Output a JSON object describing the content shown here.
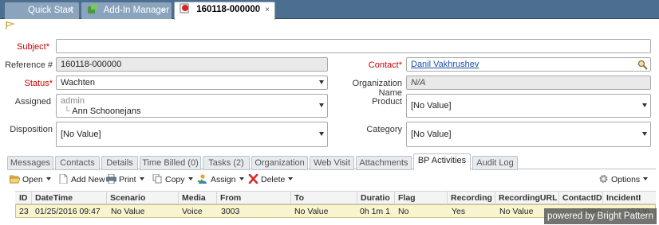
{
  "tabs": [
    {
      "label": "Quick Start",
      "close": "×"
    },
    {
      "label": "Add-In Manager",
      "close": "×"
    },
    {
      "label": "160118-000000",
      "close": "×"
    }
  ],
  "form": {
    "subject": {
      "label": "Subject",
      "required": "*",
      "value": ""
    },
    "reference": {
      "label": "Reference #",
      "value": "160118-000000"
    },
    "status": {
      "label": "Status",
      "required": "*",
      "value": "Wachten"
    },
    "assigned": {
      "label": "Assigned",
      "group": "admin",
      "tree_prefix": "└",
      "value": "Ann Schoonejans"
    },
    "disposition": {
      "label": "Disposition",
      "value": "[No Value]"
    },
    "contact": {
      "label": "Contact",
      "required": "*",
      "value": "Danil Vakhrushev"
    },
    "organization": {
      "label": "Organization Name",
      "value": "N/A"
    },
    "product": {
      "label": "Product",
      "value": "[No Value]"
    },
    "category": {
      "label": "Category",
      "value": "[No Value]"
    }
  },
  "subtabs": [
    "Messages",
    "Contacts",
    "Details",
    "Time Billed (0)",
    "Tasks (2)",
    "Organization",
    "Web Visit",
    "Attachments",
    "BP Activities",
    "Audit Log"
  ],
  "toolbar": {
    "open": "Open",
    "add_new": "Add New",
    "print": "Print",
    "copy": "Copy",
    "assign": "Assign",
    "delete": "Delete",
    "options": "Options"
  },
  "grid": {
    "columns": [
      "ID",
      "DateTime",
      "Scenario",
      "Media",
      "From",
      "To",
      "Duratio",
      "Flag",
      "Recording",
      "RecordingURL",
      "ContactID",
      "IncidentI"
    ],
    "rows": [
      [
        "23",
        "01/25/2016 09:47",
        "No Value",
        "Voice",
        "3003",
        "No Value",
        "0h 1m 1",
        "No",
        "Yes",
        "No Value",
        "1999",
        "15336"
      ]
    ]
  },
  "powered_by": "powered by Bright Pattern",
  "colors": {
    "required": "#cc0000",
    "tab_bar": "#4d6f8f",
    "row_highlight": "#f7f4cf"
  }
}
